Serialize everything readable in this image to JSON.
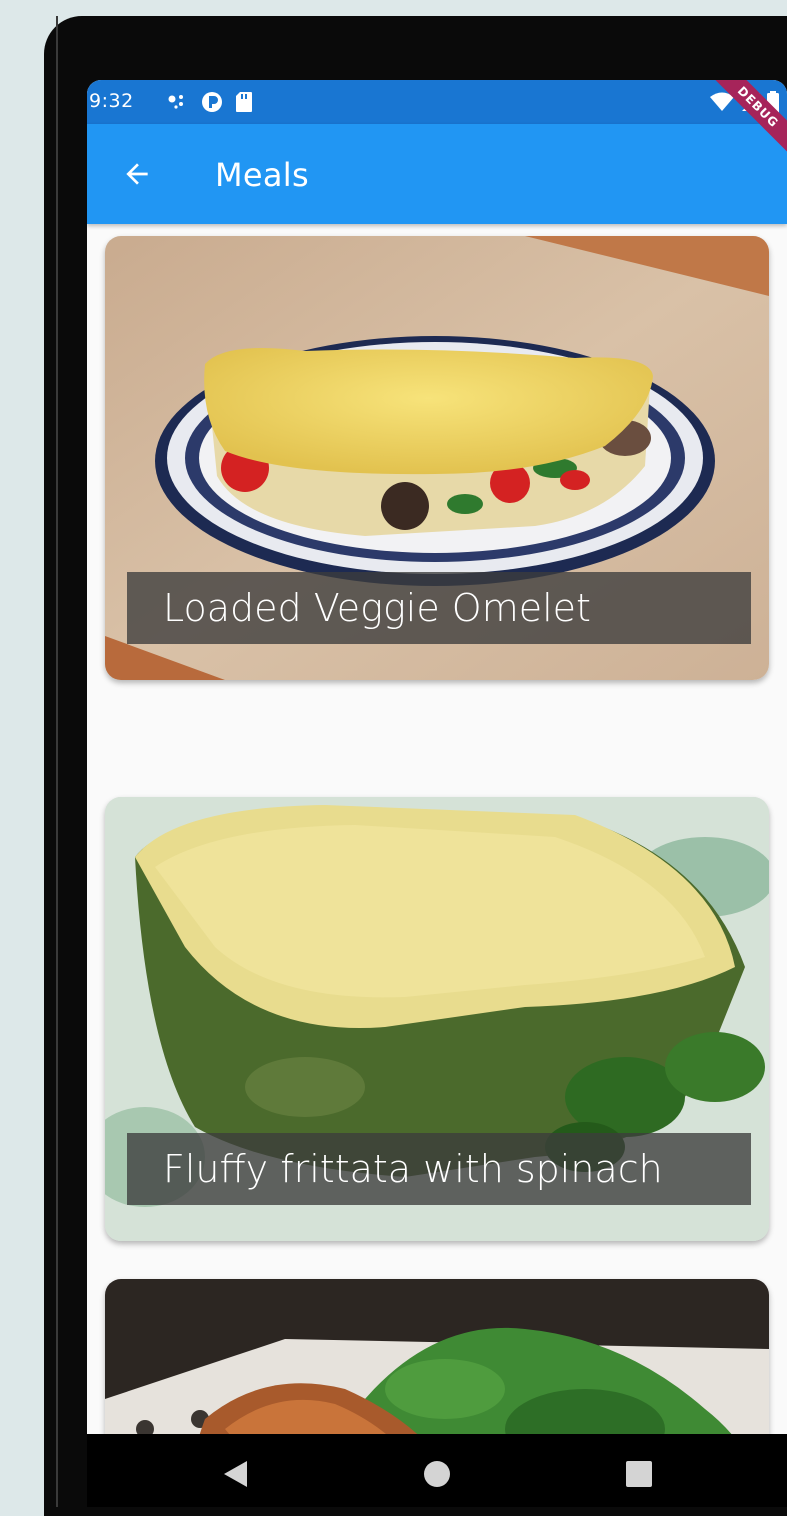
{
  "status_bar": {
    "time": "9:32",
    "left_icons": [
      "assistant-dots-icon",
      "data-saver-icon",
      "sd-card-icon"
    ],
    "right_icons": [
      "wifi-icon",
      "signal-icon",
      "battery-icon"
    ]
  },
  "debug_banner": "DEBUG",
  "app_bar": {
    "back_icon": "arrow-back-icon",
    "title": "Meals"
  },
  "meals": [
    {
      "title": "Loaded Veggie Omelet",
      "image": "omelet-photo"
    },
    {
      "title": "Fluffy frittata with spinach",
      "image": "frittata-photo"
    },
    {
      "title": "",
      "image": "chicken-salad-photo"
    }
  ],
  "nav_bar": {
    "buttons": [
      "back-triangle-icon",
      "home-circle-icon",
      "recents-square-icon"
    ]
  },
  "colors": {
    "status_bar": "#1976d2",
    "app_bar": "#2196f3",
    "debug_banner": "#a6245a",
    "background": "#fafafa"
  }
}
